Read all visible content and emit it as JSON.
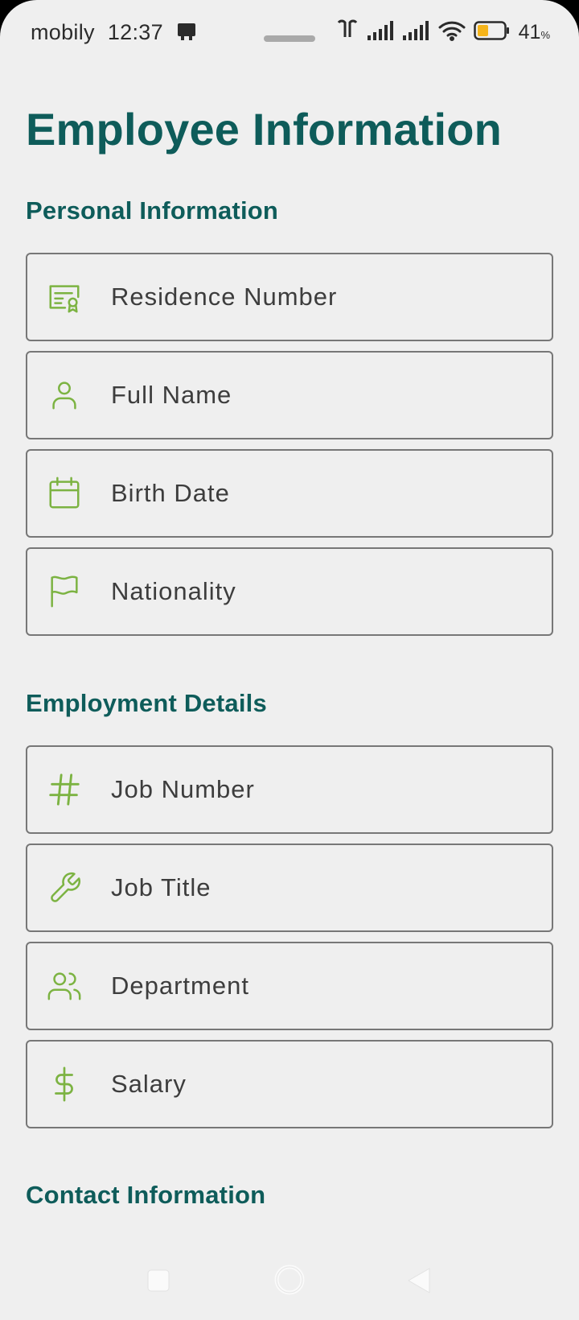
{
  "status_bar": {
    "carrier": "mobily",
    "time": "12:37",
    "battery_percent": "41",
    "battery_symbol": "%",
    "battery_level": 0.41,
    "battery_color": "#f5b41a"
  },
  "page": {
    "title": "Employee Information"
  },
  "sections": {
    "personal": {
      "title": "Personal Information",
      "fields": [
        {
          "label": "Residence Number",
          "icon": "id-card-icon"
        },
        {
          "label": "Full Name",
          "icon": "person-icon"
        },
        {
          "label": "Birth Date",
          "icon": "calendar-icon"
        },
        {
          "label": "Nationality",
          "icon": "flag-icon"
        }
      ]
    },
    "employment": {
      "title": "Employment Details",
      "fields": [
        {
          "label": "Job Number",
          "icon": "hash-icon"
        },
        {
          "label": "Job Title",
          "icon": "wrench-icon"
        },
        {
          "label": "Department",
          "icon": "users-icon"
        },
        {
          "label": "Salary",
          "icon": "dollar-icon"
        }
      ]
    },
    "contact": {
      "title": "Contact Information"
    }
  },
  "colors": {
    "accent": "#0e5c5a",
    "icon_green": "#7cb342",
    "background": "#efefef"
  }
}
